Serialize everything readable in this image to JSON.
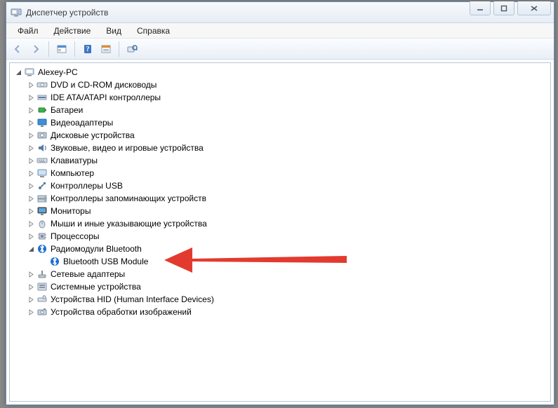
{
  "window": {
    "title": "Диспетчер устройств"
  },
  "menu": {
    "file": "Файл",
    "action": "Действие",
    "view": "Вид",
    "help": "Справка"
  },
  "tree": {
    "root": "Alexey-PC",
    "items": [
      {
        "label": "DVD и CD-ROM дисководы",
        "icon": "disc-drive"
      },
      {
        "label": "IDE ATA/ATAPI контроллеры",
        "icon": "ide"
      },
      {
        "label": "Батареи",
        "icon": "battery"
      },
      {
        "label": "Видеоадаптеры",
        "icon": "display"
      },
      {
        "label": "Дисковые устройства",
        "icon": "hdd"
      },
      {
        "label": "Звуковые, видео и игровые устройства",
        "icon": "sound"
      },
      {
        "label": "Клавиатуры",
        "icon": "keyboard"
      },
      {
        "label": "Компьютер",
        "icon": "computer"
      },
      {
        "label": "Контроллеры USB",
        "icon": "usb"
      },
      {
        "label": "Контроллеры запоминающих устройств",
        "icon": "storage-ctrl"
      },
      {
        "label": "Мониторы",
        "icon": "monitor"
      },
      {
        "label": "Мыши и иные указывающие устройства",
        "icon": "mouse"
      },
      {
        "label": "Процессоры",
        "icon": "cpu"
      },
      {
        "label": "Радиомодули Bluetooth",
        "icon": "bluetooth",
        "expanded": true,
        "children": [
          {
            "label": "Bluetooth USB Module",
            "icon": "bluetooth"
          }
        ]
      },
      {
        "label": "Сетевые адаптеры",
        "icon": "network"
      },
      {
        "label": "Системные устройства",
        "icon": "system"
      },
      {
        "label": "Устройства HID (Human Interface Devices)",
        "icon": "hid"
      },
      {
        "label": "Устройства обработки изображений",
        "icon": "imaging"
      }
    ]
  }
}
